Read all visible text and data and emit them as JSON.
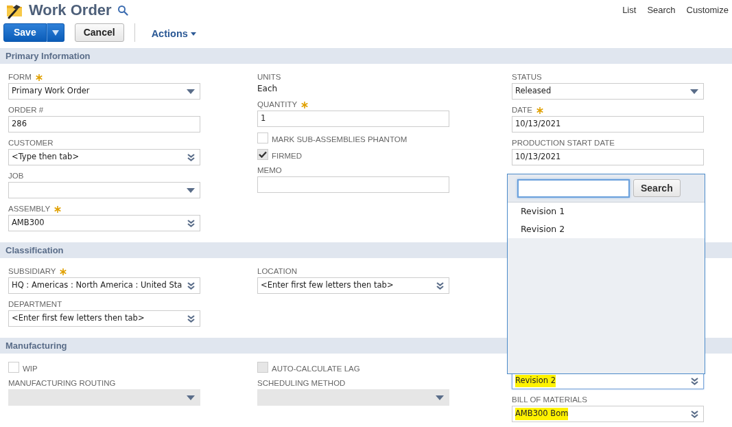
{
  "header": {
    "title": "Work Order",
    "links": [
      "List",
      "Search",
      "Customize"
    ]
  },
  "toolbar": {
    "save": "Save",
    "cancel": "Cancel",
    "actions": "Actions"
  },
  "sections": [
    {
      "title": "Primary Information",
      "columns": [
        [
          {
            "kind": "select",
            "label": "FORM",
            "required": true,
            "value": "Primary Work Order"
          },
          {
            "kind": "text",
            "label": "ORDER #",
            "value": "286"
          },
          {
            "kind": "lookup",
            "label": "CUSTOMER",
            "value": "<Type then tab>"
          },
          {
            "kind": "select",
            "label": "JOB"
          },
          {
            "kind": "lookup",
            "label": "ASSEMBLY",
            "required": true,
            "value": "AMB300"
          }
        ],
        [
          {
            "kind": "static",
            "label": "UNITS",
            "value": "Each"
          },
          {
            "kind": "text",
            "label": "QUANTITY",
            "required": true,
            "value": "1"
          },
          {
            "kind": "checkbox",
            "label": "MARK SUB-ASSEMBLIES PHANTOM",
            "checked": false
          },
          {
            "kind": "checkbox",
            "label": "FIRMED",
            "checked": true
          },
          {
            "kind": "text",
            "label": "MEMO"
          }
        ],
        [
          {
            "kind": "select",
            "label": "STATUS",
            "value": "Released"
          },
          {
            "kind": "text",
            "label": "DATE",
            "required": true,
            "value": "10/13/2021"
          },
          {
            "kind": "text",
            "label": "PRODUCTION START DATE",
            "value": "10/13/2021"
          }
        ]
      ]
    },
    {
      "title": "Classification",
      "columns": [
        [
          {
            "kind": "lookup",
            "label": "SUBSIDIARY",
            "required": true,
            "value": "HQ : Americas : North America : United Sta"
          },
          {
            "kind": "lookup",
            "label": "DEPARTMENT",
            "value": "<Enter first few letters then tab>"
          }
        ],
        [
          {
            "kind": "lookup",
            "label": "LOCATION",
            "value": "<Enter first few letters then tab>"
          }
        ],
        []
      ]
    },
    {
      "title": "Manufacturing",
      "columns": [
        [
          {
            "kind": "checkbox",
            "label": "WIP",
            "checked": false
          },
          {
            "kind": "select",
            "label": "MANUFACTURING ROUTING",
            "disabled": true
          }
        ],
        [
          {
            "kind": "checkbox",
            "label": "AUTO-CALCULATE LAG",
            "checked": false,
            "disabled": true
          },
          {
            "kind": "select",
            "label": "SCHEDULING METHOD",
            "disabled": true
          }
        ],
        [
          {
            "kind": "lookup",
            "value": "Revision 2",
            "highlighted": true,
            "focused": true
          },
          {
            "kind": "lookup",
            "label": "BILL OF MATERIALS",
            "value": "AMB300 Bom",
            "highlighted": true
          }
        ]
      ]
    }
  ],
  "popup": {
    "search_button": "Search",
    "options": [
      {
        "label": "Revision 1",
        "selected": false
      },
      {
        "label": "Revision 2",
        "selected": false
      }
    ]
  }
}
